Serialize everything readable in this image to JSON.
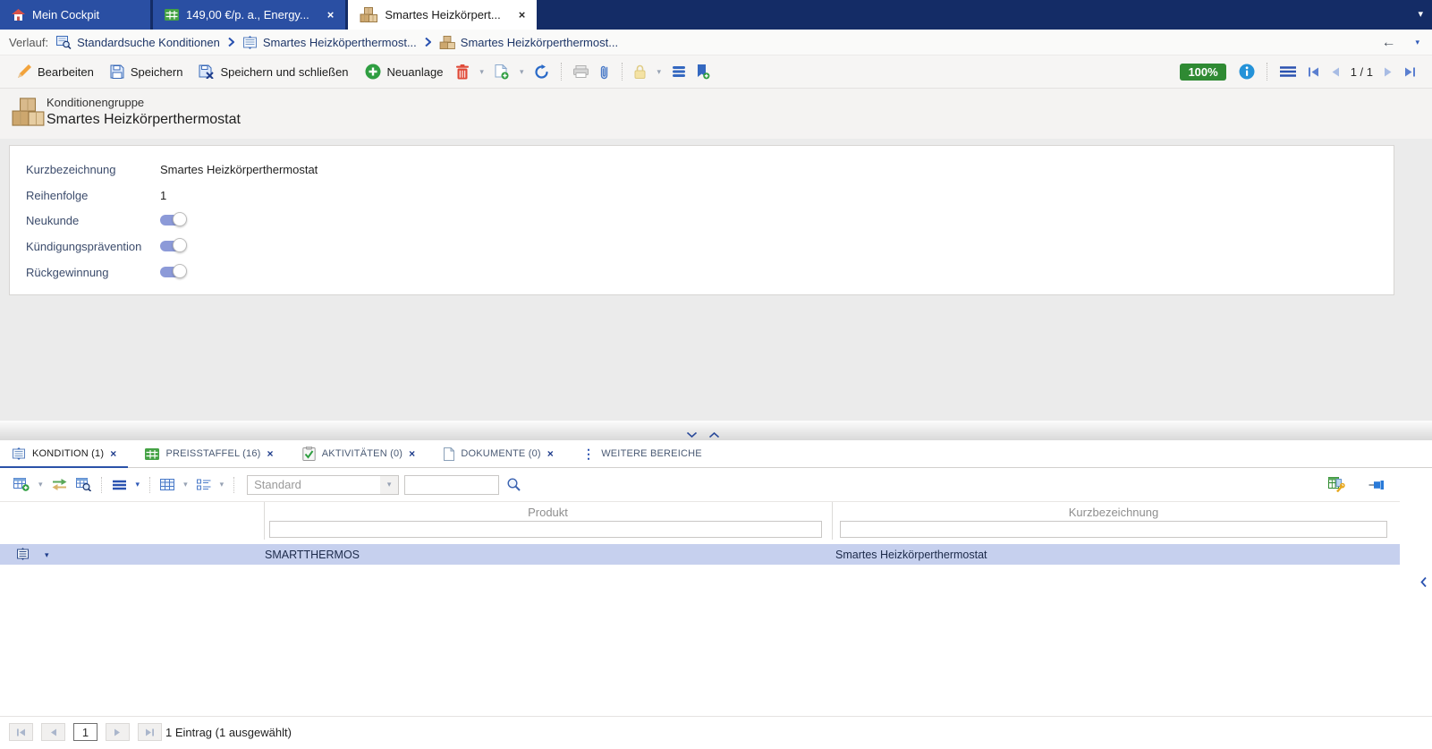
{
  "icons": {
    "close": "×",
    "caret_down": "▾",
    "dots_vertical": "⋮",
    "back_arrow": "←"
  },
  "top_tabs": [
    {
      "label": "Mein Cockpit",
      "icon": "home-icon",
      "active": false,
      "closable": false
    },
    {
      "label": "149,00 €/p. a., Energy...",
      "icon": "table-icon",
      "active": false,
      "closable": true
    },
    {
      "label": "Smartes Heizkörpert...",
      "icon": "packages-icon",
      "active": true,
      "closable": true
    }
  ],
  "breadcrumb": {
    "prefix": "Verlauf:",
    "items": [
      {
        "label": "Standardsuche Konditionen",
        "icon": "search-records-icon"
      },
      {
        "label": "Smartes Heizköperthermost...",
        "icon": "dossier-icon"
      },
      {
        "label": "Smartes Heizkörperthermost...",
        "icon": "packages-icon"
      }
    ]
  },
  "toolbar": {
    "edit_label": "Bearbeiten",
    "save_label": "Speichern",
    "save_close_label": "Speichern und schließen",
    "new_label": "Neuanlage",
    "zoom_badge": "100%",
    "page_indicator": "1 / 1"
  },
  "record_header": {
    "type_label": "Konditionengruppe",
    "title": "Smartes Heizkörperthermostat"
  },
  "form": {
    "fields": [
      {
        "label": "Kurzbezeichnung",
        "value": "Smartes Heizkörperthermostat",
        "type": "text"
      },
      {
        "label": "Reihenfolge",
        "value": "1",
        "type": "text"
      },
      {
        "label": "Neukunde",
        "value": "on",
        "type": "toggle"
      },
      {
        "label": "Kündigungsprävention",
        "value": "on",
        "type": "toggle"
      },
      {
        "label": "Rückgewinnung",
        "value": "on",
        "type": "toggle"
      }
    ]
  },
  "subtabs": [
    {
      "label": "KONDITION (1)",
      "active": true,
      "closable": true
    },
    {
      "label": "PREISSTAFFEL (16)",
      "active": false,
      "closable": true
    },
    {
      "label": "AKTIVITÄTEN (0)",
      "active": false,
      "closable": true
    },
    {
      "label": "DOKUMENTE (0)",
      "active": false,
      "closable": true
    },
    {
      "label": "WEITERE BEREICHE",
      "active": false,
      "closable": false
    }
  ],
  "list_toolbar": {
    "view_selector_value": "Standard",
    "search_value": ""
  },
  "grid": {
    "columns": [
      {
        "label": ""
      },
      {
        "label": "Produkt"
      },
      {
        "label": "Kurzbezeichnung"
      }
    ],
    "rows": [
      {
        "produkt": "SMARTTHERMOS",
        "kurzbezeichnung": "Smartes Heizkörperthermostat"
      }
    ]
  },
  "pager": {
    "current_page": "1",
    "status": "1 Eintrag (1 ausgewählt)"
  },
  "colors": {
    "accent_blue": "#2b52a8",
    "tabbar_bg": "#142c66",
    "inactive_tab": "#2a4fa3",
    "selected_row": "#c6d0ee",
    "toggle_on": "#8c9ad8",
    "zoom_badge_green": "#2f8a33"
  }
}
